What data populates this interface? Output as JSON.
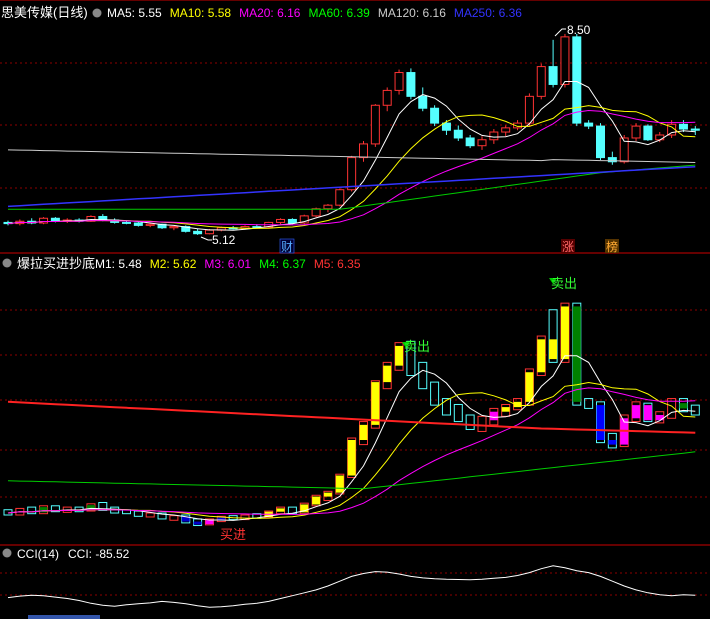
{
  "panels": {
    "main": {
      "title": "思美传媒(日线)",
      "indicators": [
        {
          "label": "MA5: 5.55",
          "color": "#ffffff"
        },
        {
          "label": "MA10: 5.58",
          "color": "#ffff00"
        },
        {
          "label": "MA20: 6.16",
          "color": "#ff00ff"
        },
        {
          "label": "MA60: 6.39",
          "color": "#00ff00"
        },
        {
          "label": "MA120: 6.16",
          "color": "#cccccc"
        },
        {
          "label": "MA250: 6.36",
          "color": "#3333ff"
        }
      ],
      "annotations": {
        "high": "8.50",
        "low": "5.12",
        "cai": "财",
        "zhang": "涨",
        "bang": "榜"
      }
    },
    "mid": {
      "title": "爆拉买进抄底",
      "indicators": [
        {
          "label": "M1: 5.48",
          "color": "#ffffff"
        },
        {
          "label": "M2: 5.62",
          "color": "#ffff00"
        },
        {
          "label": "M3: 6.01",
          "color": "#ff00ff"
        },
        {
          "label": "M4: 6.37",
          "color": "#00ff00"
        },
        {
          "label": "M5: 6.35",
          "color": "#ff3333"
        }
      ],
      "annotations": {
        "sell1": "卖出",
        "sell2": "卖出",
        "buy": "买进"
      }
    },
    "cci": {
      "title": "CCI(14)",
      "indicators": [
        {
          "label": "CCI: -85.52",
          "color": "#ffffff"
        }
      ]
    }
  },
  "colors": {
    "up": "#ff3333",
    "down": "#55ffff",
    "grid": "#8b0000",
    "yellow": "#ffff00",
    "magenta": "#ff00ff",
    "blue": "#0000ff",
    "green": "#008000"
  },
  "chart_data": {
    "type": "candlestick",
    "price_range": [
      4.9,
      8.7
    ],
    "ohlc": [
      [
        5.33,
        5.36,
        5.28,
        5.31
      ],
      [
        5.31,
        5.38,
        5.28,
        5.35
      ],
      [
        5.35,
        5.4,
        5.3,
        5.32
      ],
      [
        5.32,
        5.42,
        5.3,
        5.4
      ],
      [
        5.4,
        5.42,
        5.33,
        5.35
      ],
      [
        5.35,
        5.4,
        5.32,
        5.37
      ],
      [
        5.37,
        5.4,
        5.33,
        5.35
      ],
      [
        5.35,
        5.45,
        5.34,
        5.43
      ],
      [
        5.43,
        5.47,
        5.35,
        5.37
      ],
      [
        5.37,
        5.4,
        5.31,
        5.33
      ],
      [
        5.33,
        5.36,
        5.3,
        5.32
      ],
      [
        5.32,
        5.34,
        5.26,
        5.28
      ],
      [
        5.28,
        5.31,
        5.25,
        5.3
      ],
      [
        5.3,
        5.31,
        5.22,
        5.24
      ],
      [
        5.24,
        5.27,
        5.2,
        5.26
      ],
      [
        5.26,
        5.28,
        5.16,
        5.18
      ],
      [
        5.18,
        5.22,
        5.12,
        5.14
      ],
      [
        5.14,
        5.22,
        5.13,
        5.2
      ],
      [
        5.2,
        5.26,
        5.18,
        5.24
      ],
      [
        5.24,
        5.27,
        5.21,
        5.23
      ],
      [
        5.23,
        5.28,
        5.21,
        5.26
      ],
      [
        5.26,
        5.3,
        5.23,
        5.25
      ],
      [
        5.25,
        5.34,
        5.24,
        5.33
      ],
      [
        5.33,
        5.4,
        5.3,
        5.38
      ],
      [
        5.38,
        5.4,
        5.3,
        5.32
      ],
      [
        5.32,
        5.46,
        5.3,
        5.44
      ],
      [
        5.44,
        5.58,
        5.42,
        5.56
      ],
      [
        5.56,
        5.64,
        5.5,
        5.62
      ],
      [
        5.62,
        5.9,
        5.6,
        5.88
      ],
      [
        5.88,
        6.45,
        5.85,
        6.42
      ],
      [
        6.42,
        6.7,
        6.35,
        6.65
      ],
      [
        6.65,
        7.32,
        6.6,
        7.3
      ],
      [
        7.3,
        7.6,
        7.2,
        7.55
      ],
      [
        7.55,
        7.9,
        7.48,
        7.85
      ],
      [
        7.85,
        7.92,
        7.4,
        7.45
      ],
      [
        7.45,
        7.6,
        7.2,
        7.25
      ],
      [
        7.25,
        7.3,
        6.95,
        7.0
      ],
      [
        7.0,
        7.05,
        6.8,
        6.88
      ],
      [
        6.88,
        6.96,
        6.7,
        6.75
      ],
      [
        6.75,
        6.8,
        6.58,
        6.62
      ],
      [
        6.62,
        6.78,
        6.55,
        6.72
      ],
      [
        6.72,
        6.9,
        6.65,
        6.85
      ],
      [
        6.85,
        6.96,
        6.78,
        6.92
      ],
      [
        6.92,
        7.05,
        6.88,
        7.0
      ],
      [
        7.0,
        7.5,
        6.95,
        7.45
      ],
      [
        7.45,
        8.0,
        7.4,
        7.95
      ],
      [
        7.95,
        8.4,
        7.6,
        7.65
      ],
      [
        7.65,
        8.5,
        7.6,
        8.45
      ],
      [
        8.45,
        8.5,
        6.95,
        7.0
      ],
      [
        7.0,
        7.05,
        6.9,
        6.95
      ],
      [
        6.95,
        7.0,
        6.38,
        6.42
      ],
      [
        6.42,
        6.52,
        6.3,
        6.35
      ],
      [
        6.35,
        6.8,
        6.32,
        6.75
      ],
      [
        6.75,
        7.0,
        6.7,
        6.95
      ],
      [
        6.95,
        6.98,
        6.7,
        6.72
      ],
      [
        6.72,
        6.85,
        6.68,
        6.8
      ],
      [
        6.8,
        7.05,
        6.75,
        6.98
      ],
      [
        6.98,
        7.05,
        6.85,
        6.9
      ],
      [
        6.9,
        6.95,
        6.8,
        6.88
      ]
    ],
    "cci": [
      -110,
      -95,
      -85,
      -90,
      -105,
      -120,
      -140,
      -170,
      -190,
      -200,
      -185,
      -175,
      -165,
      -150,
      -160,
      -175,
      -195,
      -210,
      -205,
      -195,
      -180,
      -170,
      -150,
      -120,
      -90,
      -60,
      -30,
      10,
      60,
      110,
      140,
      160,
      155,
      135,
      110,
      95,
      85,
      80,
      78,
      76,
      80,
      90,
      100,
      120,
      150,
      190,
      220,
      200,
      170,
      150,
      110,
      60,
      10,
      -30,
      -60,
      -80,
      -90,
      -80,
      -85
    ]
  }
}
